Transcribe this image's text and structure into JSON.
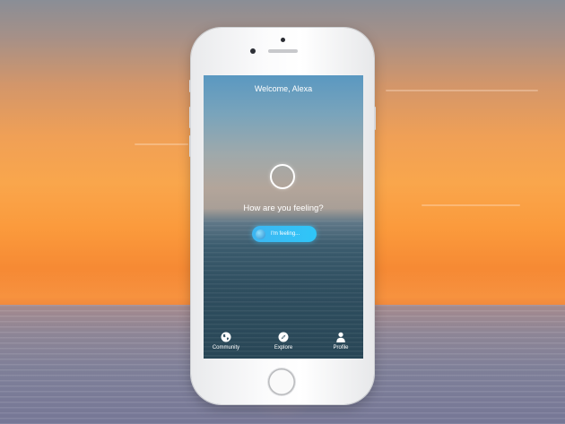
{
  "app": {
    "greeting": "Welcome, Alexa",
    "question": "How are you feeling?",
    "feeling_button_label": "I'm feeling..."
  },
  "tabs": [
    {
      "label": "Community",
      "icon": "globe-icon"
    },
    {
      "label": "Explore",
      "icon": "compass-icon"
    },
    {
      "label": "Profile",
      "icon": "person-icon"
    }
  ],
  "colors": {
    "accent": "#2fbff6",
    "text": "#ffffff"
  }
}
